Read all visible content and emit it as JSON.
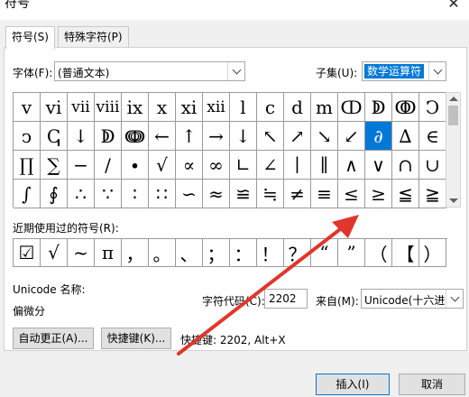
{
  "window": {
    "title": "符号",
    "close": "✕"
  },
  "tabs": [
    {
      "label": "符号(S)",
      "active": true
    },
    {
      "label": "特殊字符(P)",
      "active": false
    }
  ],
  "font": {
    "label": "字体(F):",
    "value": "(普通文本)"
  },
  "subset": {
    "label": "子集(U):",
    "value": "数学运算符"
  },
  "symbols": [
    "v",
    "vi",
    "vii",
    "viii",
    "ix",
    "x",
    "xi",
    "xii",
    "ⅼ",
    "c",
    "d",
    "m",
    "ↀ",
    "ↁ",
    "ↂ",
    "Ↄ",
    "ↄ",
    "ↅ",
    "↓",
    "ↁ",
    "ↈ",
    "←",
    "↑",
    "→",
    "↓",
    "↖",
    "↗",
    "↘",
    "↙",
    "∂",
    "∆",
    "∈",
    "∏",
    "∑",
    "−",
    "∕",
    "∙",
    "√",
    "∝",
    "∞",
    "∟",
    "∠",
    "∣",
    "∥",
    "∧",
    "∨",
    "∩",
    "∪",
    "∫",
    "∮",
    "∴",
    "∵",
    "∶",
    "∷",
    "∽",
    "≈",
    "≌",
    "≒",
    "≠",
    "≡",
    "≤",
    "≥",
    "≦",
    "≧"
  ],
  "selected_index": 29,
  "recent": {
    "label": "近期使用过的符号(R):",
    "items": [
      "☑",
      "√",
      "~",
      "π",
      "，",
      "。",
      "、",
      "；",
      "：",
      "！",
      "？",
      "“",
      "”",
      "（",
      "【",
      "）"
    ]
  },
  "unicode_name": {
    "label": "Unicode 名称:",
    "value": "偏微分"
  },
  "char_code": {
    "label": "字符代码(C):",
    "value": "2202"
  },
  "from": {
    "label": "来自(M):",
    "value": "Unicode(十六进"
  },
  "buttons": {
    "autocorrect": "自动更正(A)...",
    "shortcut_key": "快捷键(K)...",
    "shortcut_text": "快捷键: 2202, Alt+X",
    "insert": "插入(I)",
    "cancel": "取消"
  },
  "colors": {
    "accent": "#0078d7",
    "annotation_arrow": "#e0362c"
  }
}
